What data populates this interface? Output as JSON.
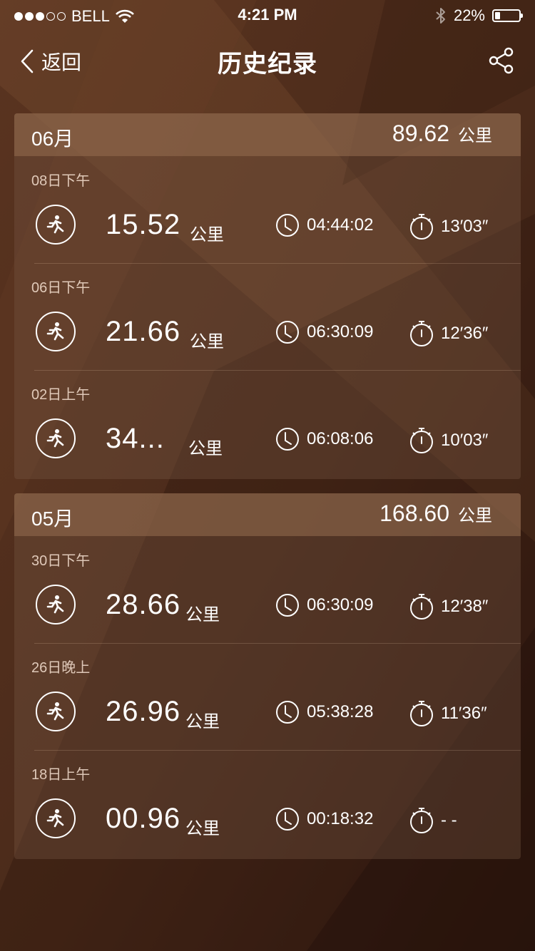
{
  "status_bar": {
    "carrier": "BELL",
    "time": "4:21 PM",
    "battery": "22%",
    "battery_level": 0.22,
    "signal_bars": 3,
    "signal_total": 5
  },
  "nav": {
    "back_label": "返回",
    "title": "历史纪录"
  },
  "months": [
    {
      "label": "06月",
      "total": "89.62",
      "unit": "公里",
      "runs": [
        {
          "date": "08日下午",
          "distance": "15.52",
          "unit": "公里",
          "duration": "04:44:02",
          "pace": "13′03″"
        },
        {
          "date": "06日下午",
          "distance": "21.66",
          "unit": "公里",
          "duration": "06:30:09",
          "pace": "12′36″"
        },
        {
          "date": "02日上午",
          "distance": "34...",
          "unit": "公里",
          "duration": "06:08:06",
          "pace": "10′03″"
        }
      ]
    },
    {
      "label": "05月",
      "total": "168.60",
      "unit": "公里",
      "runs": [
        {
          "date": "30日下午",
          "distance": "28.66",
          "unit": "公里",
          "duration": "06:30:09",
          "pace": "12′38″"
        },
        {
          "date": "26日晚上",
          "distance": "26.96",
          "unit": "公里",
          "duration": "05:38:28",
          "pace": "11′36″"
        },
        {
          "date": "18日上午",
          "distance": "00.96",
          "unit": "公里",
          "duration": "00:18:32",
          "pace": "- -"
        }
      ]
    }
  ],
  "colors": {
    "background": "#3a1f14",
    "accent": "#8a6a4e"
  },
  "icons": {
    "back": "chevron-left-icon",
    "share": "share-icon",
    "run": "runner-icon",
    "duration": "clock-icon",
    "pace": "stopwatch-icon"
  }
}
